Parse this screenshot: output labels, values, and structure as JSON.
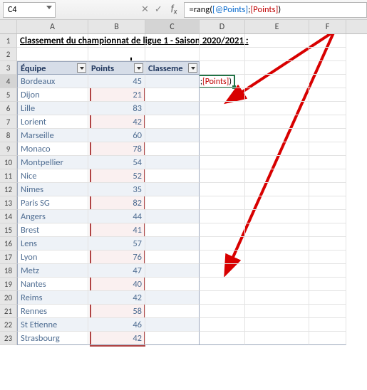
{
  "namebox": "C4",
  "formula": {
    "prefix": "=rang(",
    "arg1": "[@Points]",
    "sep": ";",
    "arg2": "[Points]",
    "suffix": ")"
  },
  "title": "Classement du championnat de ligue 1 - Saison 2020/2021 :",
  "columns": [
    "A",
    "B",
    "C",
    "D",
    "E",
    "F"
  ],
  "headers": {
    "team": "Équipe",
    "points": "Points",
    "rank": "Classeme"
  },
  "active_cell_display": "ts];[Points])",
  "rows": [
    {
      "n": 1
    },
    {
      "n": 2
    },
    {
      "n": 3,
      "header": true
    },
    {
      "n": 4,
      "team": "Bordeaux",
      "points": 45,
      "band": true,
      "active": true
    },
    {
      "n": 5,
      "team": "Dijon",
      "points": 21
    },
    {
      "n": 6,
      "team": "Lille",
      "points": 83,
      "band": true
    },
    {
      "n": 7,
      "team": "Lorient",
      "points": 42
    },
    {
      "n": 8,
      "team": "Marseille",
      "points": 60,
      "band": true
    },
    {
      "n": 9,
      "team": "Monaco",
      "points": 78
    },
    {
      "n": 10,
      "team": "Montpellier",
      "points": 54,
      "band": true
    },
    {
      "n": 11,
      "team": "Nice",
      "points": 52
    },
    {
      "n": 12,
      "team": "Nimes",
      "points": 35,
      "band": true
    },
    {
      "n": 13,
      "team": "Paris SG",
      "points": 82
    },
    {
      "n": 14,
      "team": "Angers",
      "points": 44,
      "band": true
    },
    {
      "n": 15,
      "team": "Brest",
      "points": 41
    },
    {
      "n": 16,
      "team": "Lens",
      "points": 57,
      "band": true
    },
    {
      "n": 17,
      "team": "Lyon",
      "points": 76
    },
    {
      "n": 18,
      "team": "Metz",
      "points": 47,
      "band": true
    },
    {
      "n": 19,
      "team": "Nantes",
      "points": 40
    },
    {
      "n": 20,
      "team": "Reims",
      "points": 42,
      "band": true
    },
    {
      "n": 21,
      "team": "Rennes",
      "points": 58
    },
    {
      "n": 22,
      "team": "St Etienne",
      "points": 46,
      "band": true
    },
    {
      "n": 23,
      "team": "Strasbourg",
      "points": 42,
      "last": true
    }
  ],
  "chart_data": {
    "type": "table",
    "title": "Classement du championnat de ligue 1 - Saison 2020/2021",
    "columns": [
      "Équipe",
      "Points"
    ],
    "data": [
      [
        "Bordeaux",
        45
      ],
      [
        "Dijon",
        21
      ],
      [
        "Lille",
        83
      ],
      [
        "Lorient",
        42
      ],
      [
        "Marseille",
        60
      ],
      [
        "Monaco",
        78
      ],
      [
        "Montpellier",
        54
      ],
      [
        "Nice",
        52
      ],
      [
        "Nimes",
        35
      ],
      [
        "Paris SG",
        82
      ],
      [
        "Angers",
        44
      ],
      [
        "Brest",
        41
      ],
      [
        "Lens",
        57
      ],
      [
        "Lyon",
        76
      ],
      [
        "Metz",
        47
      ],
      [
        "Nantes",
        40
      ],
      [
        "Reims",
        42
      ],
      [
        "Rennes",
        58
      ],
      [
        "St Etienne",
        46
      ],
      [
        "Strasbourg",
        42
      ]
    ]
  }
}
